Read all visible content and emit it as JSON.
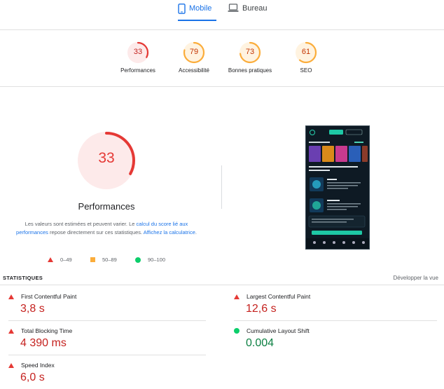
{
  "tabs": [
    {
      "label": "Mobile",
      "active": true
    },
    {
      "label": "Bureau",
      "active": false
    }
  ],
  "summary": [
    {
      "score": "33",
      "label": "Performances",
      "color": "#e53935",
      "bg": "#fdeaea",
      "text_color": "#c5221f",
      "fraction": 0.33
    },
    {
      "score": "79",
      "label": "Accessibilité",
      "color": "#fbad3b",
      "bg": "#fff3e0",
      "text_color": "#c33300",
      "fraction": 0.79
    },
    {
      "score": "73",
      "label": "Bonnes pratiques",
      "color": "#fbad3b",
      "bg": "#fff3e0",
      "text_color": "#c33300",
      "fraction": 0.73
    },
    {
      "score": "61",
      "label": "SEO",
      "color": "#fbad3b",
      "bg": "#fff3e0",
      "text_color": "#c33300",
      "fraction": 0.61
    }
  ],
  "main": {
    "score": "33",
    "fraction": 0.33,
    "label": "Performances",
    "note": {
      "part1": "Les valeurs sont estimées et peuvent varier. Le ",
      "link1": "calcul du score lié aux performances",
      "part2": " repose directement sur ces statistiques. ",
      "link2": "Affichez la calculatrice",
      "part3": "."
    },
    "legend": [
      {
        "shape": "triangle",
        "range": "0–49"
      },
      {
        "shape": "square",
        "range": "50–89"
      },
      {
        "shape": "circle",
        "range": "90–100"
      }
    ]
  },
  "stats": {
    "title": "STATISTIQUES",
    "expand": "Développer la vue",
    "metrics": [
      {
        "name": "First Contentful Paint",
        "value": "3,8 s",
        "status": "bad"
      },
      {
        "name": "Largest Contentful Paint",
        "value": "12,6 s",
        "status": "bad"
      },
      {
        "name": "Total Blocking Time",
        "value": "4 390 ms",
        "status": "bad"
      },
      {
        "name": "Cumulative Layout Shift",
        "value": "0.004",
        "status": "good"
      },
      {
        "name": "Speed Index",
        "value": "6,0 s",
        "status": "bad"
      }
    ]
  }
}
